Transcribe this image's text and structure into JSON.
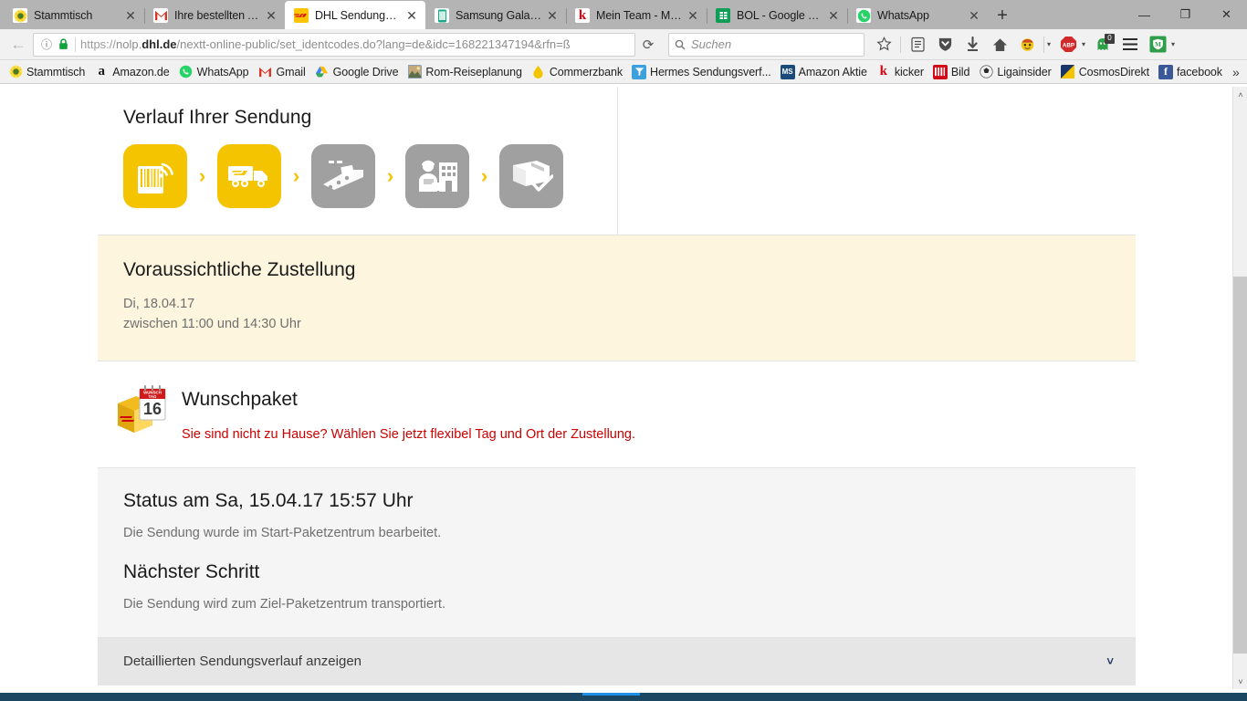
{
  "browser": {
    "tabs": [
      {
        "title": "Stammtisch",
        "favicon": "sunflower-icon",
        "active": false
      },
      {
        "title": "Ihre bestellten Ar...",
        "favicon": "gmail-icon",
        "active": false
      },
      {
        "title": "DHL Sendungsve...",
        "favicon": "dhl-icon",
        "active": true
      },
      {
        "title": "Samsung Galaxy ...",
        "favicon": "phone-icon",
        "active": false
      },
      {
        "title": "Mein Team - Ma...",
        "favicon": "kicker-icon",
        "active": false
      },
      {
        "title": "BOL - Google Ta...",
        "favicon": "sheets-icon",
        "active": false
      },
      {
        "title": "WhatsApp",
        "favicon": "whatsapp-icon",
        "active": false
      }
    ],
    "tab_close_glyph": "✕",
    "newtab_label": "+",
    "window_controls": {
      "minimize": "—",
      "restore": "❐",
      "close": "✕"
    },
    "nav": {
      "back_glyph": "←",
      "info_glyph": "ⓘ",
      "lock_glyph": "lock-icon",
      "reload_glyph": "⟳",
      "url_scheme": "https://",
      "url_host_pre": "nolp.",
      "url_host_bold": "dhl.de",
      "url_path": "/nextt-online-public/set_identcodes.do?lang=de&idc=168221347194&rfn=ß",
      "url_full": "https://nolp.dhl.de/nextt-online-public/set_identcodes.do?lang=de&idc=168221347194&rfn=8"
    },
    "search": {
      "placeholder": "Suchen",
      "icon": "search-icon"
    },
    "toolbar_icons": [
      {
        "name": "bookmark-star-icon",
        "glyph": "☆"
      },
      {
        "name": "reader-list-icon",
        "glyph": "▤"
      },
      {
        "name": "pocket-shield-icon",
        "glyph": "♥"
      },
      {
        "name": "downloads-icon",
        "glyph": "↓"
      },
      {
        "name": "home-icon",
        "glyph": "⌂"
      },
      {
        "name": "smiley-addon-icon",
        "glyph": "☺"
      },
      {
        "name": "adblock-plus-icon",
        "glyph": "ABP"
      },
      {
        "name": "ghostery-icon",
        "glyph": "◆",
        "badge": "0"
      },
      {
        "name": "hamburger-menu-icon",
        "glyph": "☰"
      },
      {
        "name": "mcafee-shield-icon",
        "glyph": "M"
      }
    ],
    "bookmarks": [
      {
        "label": "Stammtisch",
        "icon": "sunflower-icon"
      },
      {
        "label": "Amazon.de",
        "icon": "amazon-icon"
      },
      {
        "label": "WhatsApp",
        "icon": "whatsapp-icon"
      },
      {
        "label": "Gmail",
        "icon": "gmail-icon"
      },
      {
        "label": "Google Drive",
        "icon": "drive-icon"
      },
      {
        "label": "Rom-Reiseplanung",
        "icon": "photo-icon"
      },
      {
        "label": "Commerzbank",
        "icon": "commerzbank-icon"
      },
      {
        "label": "Hermes Sendungsverf...",
        "icon": "hermes-icon"
      },
      {
        "label": "Amazon Aktie",
        "icon": "ms-icon"
      },
      {
        "label": "kicker",
        "icon": "kicker-icon"
      },
      {
        "label": "Bild",
        "icon": "bild-icon"
      },
      {
        "label": "Ligainsider",
        "icon": "ball-icon"
      },
      {
        "label": "CosmosDirekt",
        "icon": "cosmos-icon"
      },
      {
        "label": "facebook",
        "icon": "facebook-icon"
      }
    ],
    "bookmarks_overflow_glyph": "»"
  },
  "page": {
    "progress": {
      "heading": "Verlauf Ihrer Sendung",
      "chevron": "›",
      "steps": [
        {
          "name": "step-scan-barcode",
          "state": "done",
          "icon": "barcode-scan-icon"
        },
        {
          "name": "step-transport-truck",
          "state": "done",
          "icon": "dhl-truck-icon"
        },
        {
          "name": "step-sorting-center",
          "state": "todo",
          "icon": "conveyor-parcel-icon"
        },
        {
          "name": "step-delivery-courier",
          "state": "todo",
          "icon": "courier-house-icon"
        },
        {
          "name": "step-delivered",
          "state": "todo",
          "icon": "parcel-check-icon"
        }
      ]
    },
    "eta": {
      "heading": "Voraussichtliche Zustellung",
      "date": "Di, 18.04.17",
      "timewindow": "zwischen 11:00 und 14:30 Uhr"
    },
    "wunschpaket": {
      "icon": "calendar-parcel-icon",
      "calendar_day": "16",
      "heading": "Wunschpaket",
      "link_text": "Sie sind nicht zu Hause? Wählen Sie jetzt flexibel Tag und Ort der Zustellung."
    },
    "status": {
      "heading": "Status am Sa, 15.04.17 15:57 Uhr",
      "text": "Die Sendung wurde im Start-Paketzentrum bearbeitet.",
      "next_heading": "Nächster Schritt",
      "next_text": "Die Sendung wird zum Ziel-Paketzentrum transportiert."
    },
    "detail_toggle": {
      "label": "Detaillierten Sendungsverlauf anzeigen",
      "chevron": "˅"
    }
  },
  "scrollbar": {
    "up_glyph": "˄",
    "down_glyph": "˅"
  },
  "colors": {
    "dhl_yellow": "#f5c400",
    "dhl_red": "#cc0000",
    "eta_background": "#fdf5dd",
    "status_background": "#f5f5f5",
    "detail_background": "#e6e6e6",
    "taskbar": "#1b4763"
  }
}
